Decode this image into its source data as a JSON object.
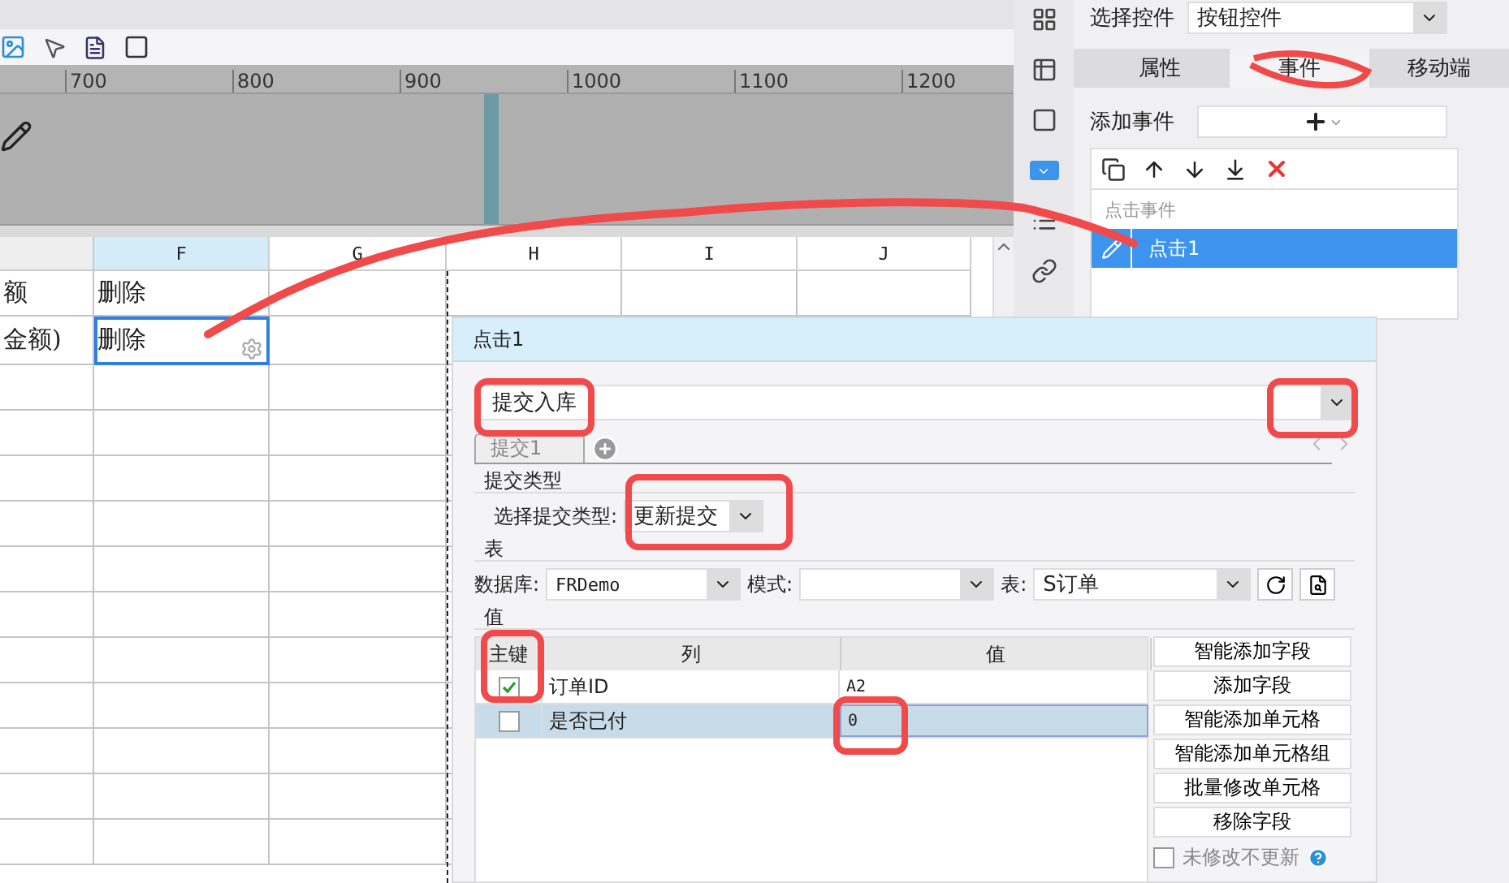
{
  "ruler": {
    "labels": [
      "700",
      "800",
      "900",
      "1000",
      "1100",
      "1200"
    ]
  },
  "sheet": {
    "columns": [
      {
        "selected": false
      },
      {
        "label": "F",
        "selected": true
      },
      {
        "label": "G",
        "selected": false
      },
      {
        "label": "H",
        "selected": false
      },
      {
        "label": "I",
        "selected": false
      },
      {
        "label": "J",
        "selected": false
      }
    ],
    "rows": [
      {
        "cells": [
          {
            "text": "额",
            "selected": false
          },
          {
            "text": "删除",
            "selected": false
          }
        ]
      },
      {
        "cells": [
          {
            "text": "金额)",
            "selected": false
          },
          {
            "text": "删除",
            "selected": true
          }
        ]
      }
    ]
  },
  "control_select": {
    "label": "选择控件",
    "value": "按钮控件"
  },
  "tabs": [
    {
      "label": "属性",
      "selected": false
    },
    {
      "label": "事件",
      "selected": true
    },
    {
      "label": "移动端",
      "selected": false
    }
  ],
  "add_event": {
    "label": "添加事件"
  },
  "events": {
    "header": "点击事件",
    "items": [
      {
        "label": "点击1",
        "selected": true
      }
    ]
  },
  "dialog": {
    "title": "点击1",
    "action": {
      "value": "提交入库"
    },
    "subtabs": [
      {
        "label": "提交1",
        "selected": true
      }
    ],
    "submit_type": {
      "section": "提交类型",
      "label": "选择提交类型:",
      "value": "更新提交"
    },
    "table": {
      "section": "表",
      "database_label": "数据库:",
      "database": "FRDemo",
      "schema_label": "模式:",
      "table_label": "表:",
      "table": "S订单"
    },
    "values": {
      "section": "值",
      "columns": [
        "主键",
        "列",
        "值"
      ],
      "rows": [
        {
          "key": true,
          "column": "订单ID",
          "value": "A2",
          "selected": false
        },
        {
          "key": false,
          "column": "是否已付",
          "value": "0",
          "selected": true
        }
      ]
    },
    "buttons": [
      "智能添加字段",
      "添加字段",
      "智能添加单元格",
      "智能添加单元格组",
      "批量修改单元格",
      "移除字段"
    ],
    "unchanged_option": {
      "label": "未修改不更新",
      "checked": false
    }
  }
}
